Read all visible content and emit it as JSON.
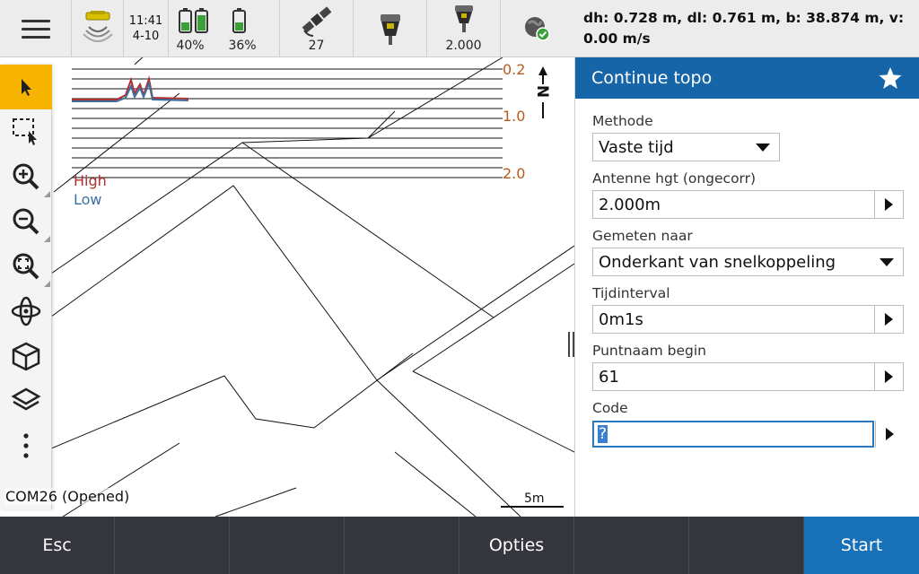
{
  "status": {
    "time": "11:41",
    "date": "4-10",
    "battery1": "40%",
    "battery2": "36%",
    "satellites": "27",
    "antenna_height": "2.000",
    "icons": [
      "menu-icon",
      "radio-icon",
      "battery-icon",
      "satellite-icon",
      "receiver-icon",
      "internet-connected-icon"
    ]
  },
  "deltas": {
    "line1": "dh: 0.728 m, dl: 0.761 m, b: 38.874 m, v:",
    "line2": "0.00 m/s"
  },
  "map": {
    "tools": [
      "select-arrow-icon",
      "box-select-icon",
      "zoom-in-icon",
      "zoom-out-icon",
      "zoom-extents-icon",
      "orbit-icon",
      "cube-view-icon",
      "layers-icon",
      "more-icon"
    ],
    "legend_high": "High",
    "legend_low": "Low",
    "precision_scale": [
      "0.2",
      "1.0",
      "2.0"
    ],
    "north_label": "N",
    "com_status": "COM26 (Opened)",
    "scale_label": "5m",
    "colors": {
      "high": "#b03030",
      "low": "#3d6fa0",
      "scale": "#b85a1a"
    }
  },
  "panel": {
    "title": "Continue topo",
    "fields": {
      "methode_label": "Methode",
      "methode_value": "Vaste tijd",
      "antenne_label": "Antenne hgt (ongecorr)",
      "antenne_value": "2.000m",
      "gemeten_label": "Gemeten naar",
      "gemeten_value": "Onderkant van snelkoppeling",
      "interval_label": "Tijdinterval",
      "interval_value": "0m1s",
      "punt_label": "Puntnaam begin",
      "punt_value": "61",
      "code_label": "Code",
      "code_value": "?"
    }
  },
  "bottombar": {
    "esc": "Esc",
    "opties": "Opties",
    "start": "Start"
  },
  "theme": {
    "accent": "#1565a8",
    "start": "#1770b8",
    "toolbar_active": "#f6b400",
    "bar_bg": "#35353d"
  }
}
